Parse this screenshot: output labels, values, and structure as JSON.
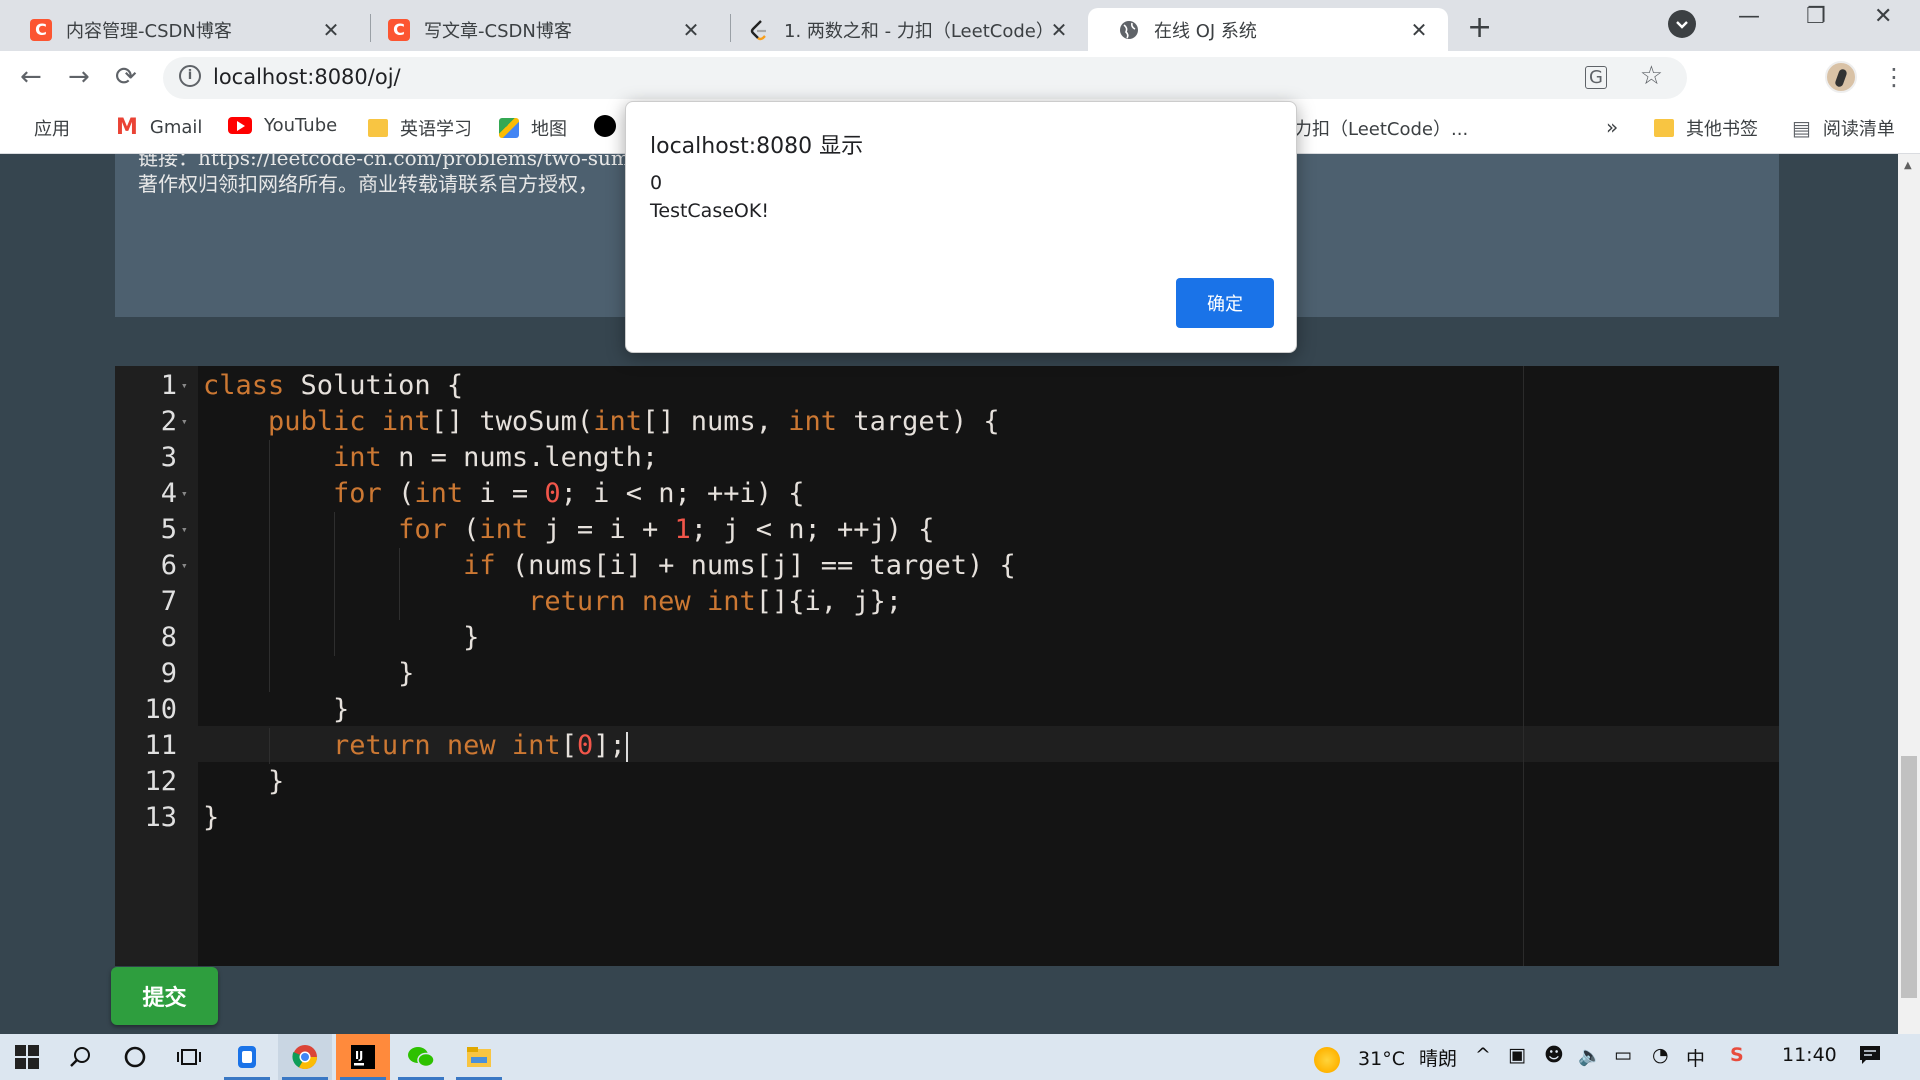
{
  "tabs": [
    {
      "title": "内容管理-CSDN博客",
      "close": "✕",
      "icon": "csdn-icon"
    },
    {
      "title": "写文章-CSDN博客",
      "close": "✕",
      "icon": "csdn-icon"
    },
    {
      "title": "1. 两数之和 - 力扣（LeetCode）",
      "close": "✕",
      "icon": "leetcode-icon"
    },
    {
      "title": "在线 OJ 系统",
      "close": "✕",
      "icon": "globe-icon"
    }
  ],
  "csdn_logo": "C",
  "new_tab": "+",
  "window_controls": {
    "minimize": "—",
    "restore": "❐",
    "close": "✕"
  },
  "nav": {
    "back": "←",
    "forward": "→",
    "reload": "⟳"
  },
  "address": {
    "url": "localhost:8080/oj/",
    "info": "i",
    "translate": "G",
    "star": "☆"
  },
  "menu": "⋮",
  "bookmarks": {
    "items": [
      "应用",
      "Gmail",
      "YouTube",
      "英语学习",
      "地图"
    ],
    "overflow_tail": "力扣（LeetCode）...",
    "more": "»",
    "other": "其他书签",
    "reading": "阅读清单"
  },
  "problem": {
    "line1": "链接：https://leetcode-cn.com/problems/two-sum/",
    "line2": "著作权归领扣网络所有。商业转载请联系官方授权，"
  },
  "editor": {
    "lines": [
      {
        "n": "1",
        "fold": true
      },
      {
        "n": "2",
        "fold": true
      },
      {
        "n": "3",
        "fold": false
      },
      {
        "n": "4",
        "fold": true
      },
      {
        "n": "5",
        "fold": true
      },
      {
        "n": "6",
        "fold": true
      },
      {
        "n": "7",
        "fold": false
      },
      {
        "n": "8",
        "fold": false
      },
      {
        "n": "9",
        "fold": false
      },
      {
        "n": "10",
        "fold": false
      },
      {
        "n": "11",
        "fold": false
      },
      {
        "n": "12",
        "fold": false
      },
      {
        "n": "13",
        "fold": false
      }
    ],
    "code": [
      [
        [
          "k",
          "class"
        ],
        [
          "t",
          " Solution {"
        ]
      ],
      [
        [
          "t",
          "    "
        ],
        [
          "k",
          "public"
        ],
        [
          "t",
          " "
        ],
        [
          "k",
          "int"
        ],
        [
          "t",
          "[] twoSum("
        ],
        [
          "k",
          "int"
        ],
        [
          "t",
          "[] nums, "
        ],
        [
          "k",
          "int"
        ],
        [
          "t",
          " target) {"
        ]
      ],
      [
        [
          "t",
          "        "
        ],
        [
          "k",
          "int"
        ],
        [
          "t",
          " n = nums.length;"
        ]
      ],
      [
        [
          "t",
          "        "
        ],
        [
          "k",
          "for"
        ],
        [
          "t",
          " ("
        ],
        [
          "k",
          "int"
        ],
        [
          "t",
          " i = "
        ],
        [
          "n",
          "0"
        ],
        [
          "t",
          "; i < n; ++i) {"
        ]
      ],
      [
        [
          "t",
          "            "
        ],
        [
          "k",
          "for"
        ],
        [
          "t",
          " ("
        ],
        [
          "k",
          "int"
        ],
        [
          "t",
          " j = i + "
        ],
        [
          "n",
          "1"
        ],
        [
          "t",
          "; j < n; ++j) {"
        ]
      ],
      [
        [
          "t",
          "                "
        ],
        [
          "k",
          "if"
        ],
        [
          "t",
          " (nums[i] + nums[j] == target) {"
        ]
      ],
      [
        [
          "t",
          "                    "
        ],
        [
          "k",
          "return"
        ],
        [
          "t",
          " "
        ],
        [
          "k",
          "new"
        ],
        [
          "t",
          " "
        ],
        [
          "k",
          "int"
        ],
        [
          "t",
          "[]{i, j};"
        ]
      ],
      [
        [
          "t",
          "                }"
        ]
      ],
      [
        [
          "t",
          "            }"
        ]
      ],
      [
        [
          "t",
          "        }"
        ]
      ],
      [
        [
          "t",
          "        "
        ],
        [
          "k",
          "return"
        ],
        [
          "t",
          " "
        ],
        [
          "k",
          "new"
        ],
        [
          "t",
          " "
        ],
        [
          "k",
          "int"
        ],
        [
          "t",
          "["
        ],
        [
          "n",
          "0"
        ],
        [
          "t",
          "];"
        ]
      ],
      [
        [
          "t",
          "    }"
        ]
      ],
      [
        [
          "t",
          "}"
        ]
      ]
    ]
  },
  "submit_label": "提交",
  "dialog": {
    "title": "localhost:8080 显示",
    "line1": "0",
    "line2": "TestCaseOK!",
    "ok_label": "确定"
  },
  "taskbar": {
    "weather_temp": "31°C",
    "weather_text": "晴朗",
    "ime": "中",
    "time": "11:40"
  },
  "colors": {
    "keyword": "#cc7833",
    "number": "#f2564a",
    "editor_bg": "#141414",
    "submit": "#2e9e3e",
    "dialog_button": "#1a73e8"
  }
}
